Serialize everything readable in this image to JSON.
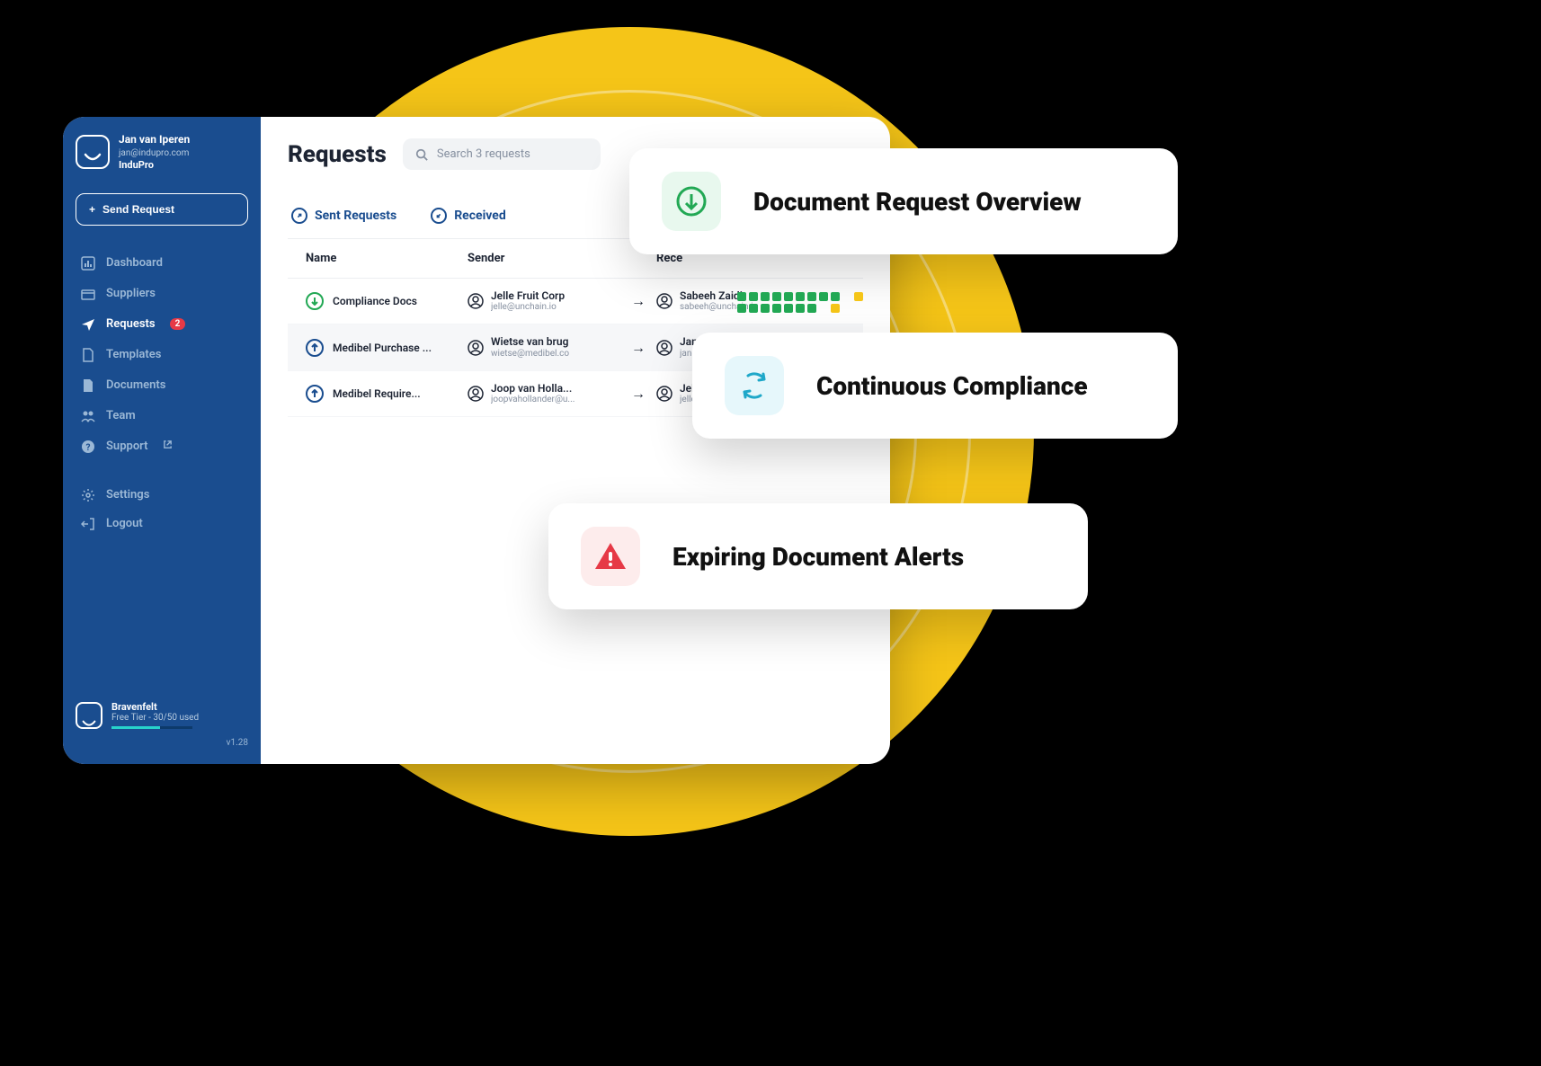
{
  "user": {
    "name": "Jan van Iperen",
    "email": "jan@indupro.com",
    "company": "InduPro"
  },
  "send_button": "Send Request",
  "nav": {
    "dashboard": "Dashboard",
    "suppliers": "Suppliers",
    "requests": "Requests",
    "requests_badge": "2",
    "templates": "Templates",
    "documents": "Documents",
    "team": "Team",
    "support": "Support",
    "settings": "Settings",
    "logout": "Logout"
  },
  "tier": {
    "name": "Bravenfelt",
    "sub": "Free Tier - 30/50 used"
  },
  "version": "v1.28",
  "page": {
    "title": "Requests",
    "search_placeholder": "Search 3 requests"
  },
  "tabs": {
    "sent": "Sent Requests",
    "received": "Received"
  },
  "columns": {
    "name": "Name",
    "sender": "Sender",
    "receiver": "Rece"
  },
  "rows": [
    {
      "direction": "down",
      "name": "Compliance Docs",
      "sender_name": "Jelle Fruit Corp",
      "sender_email": "jelle@unchain.io",
      "receiver_name": "Sabeeh Zaidi",
      "receiver_email": "sabeeh@unchain.io"
    },
    {
      "direction": "up",
      "name": "Medibel Purchase ...",
      "sender_name": "Wietse van brug",
      "sender_email": "wietse@medibel.co",
      "receiver_name": "Jan van Iper...",
      "receiver_email": "jan@bravenfelt..."
    },
    {
      "direction": "up",
      "name": "Medibel Require...",
      "sender_name": "Joop van Holla...",
      "sender_email": "joopvahollander@u...",
      "receiver_name": "Jelle Fruit Co...",
      "receiver_email": "jelle@unchain.io"
    }
  ],
  "features": {
    "f1": "Document Request Overview",
    "f2": "Continuous Compliance",
    "f3": "Expiring Document Alerts"
  }
}
